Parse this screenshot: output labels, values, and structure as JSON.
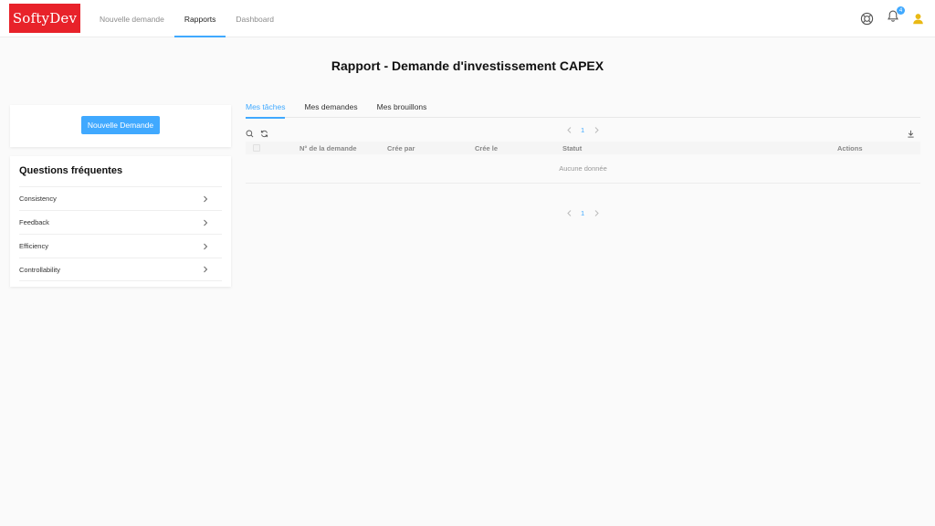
{
  "header": {
    "logo_text": "SoftyDev",
    "nav": [
      {
        "label": "Nouvelle demande"
      },
      {
        "label": "Rapports"
      },
      {
        "label": "Dashboard"
      }
    ],
    "notification_count": "4",
    "accent_color": "#40a9ff",
    "logo_color": "#e8222a",
    "icons": [
      "support-icon",
      "bell-icon",
      "user-icon"
    ]
  },
  "page": {
    "title": "Rapport - Demande d'investissement CAPEX"
  },
  "sidebar": {
    "new_request_label": "Nouvelle Demande",
    "faq_title": "Questions fréquentes",
    "faq_items": [
      {
        "label": "Consistency"
      },
      {
        "label": "Feedback"
      },
      {
        "label": "Efficiency"
      },
      {
        "label": "Controllability"
      }
    ]
  },
  "main": {
    "tabs": [
      {
        "label": "Mes tâches"
      },
      {
        "label": "Mes demandes"
      },
      {
        "label": "Mes brouillons"
      }
    ],
    "pagination": {
      "current_page": "1"
    },
    "table": {
      "columns": [
        "N° de la demande",
        "Crée par",
        "Crée le",
        "Statut",
        "Actions"
      ],
      "empty_text": "Aucune donnée"
    }
  }
}
